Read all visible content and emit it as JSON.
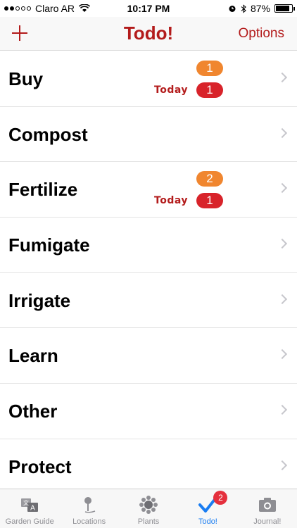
{
  "status_bar": {
    "carrier": "Claro AR",
    "time": "10:17 PM",
    "battery": "87%",
    "battery_level": 0.87
  },
  "nav": {
    "title": "Todo!",
    "options_label": "Options",
    "add_icon": "plus-icon"
  },
  "list": [
    {
      "label": "Buy",
      "pending": "1",
      "today_label": "Today",
      "today_count": "1"
    },
    {
      "label": "Compost"
    },
    {
      "label": "Fertilize",
      "pending": "2",
      "today_label": "Today",
      "today_count": "1"
    },
    {
      "label": "Fumigate"
    },
    {
      "label": "Irrigate"
    },
    {
      "label": "Learn"
    },
    {
      "label": "Other"
    },
    {
      "label": "Protect"
    }
  ],
  "tabs": [
    {
      "label": "Garden Guide",
      "icon": "garden-guide-icon"
    },
    {
      "label": "Locations",
      "icon": "location-pin-icon"
    },
    {
      "label": "Plants",
      "icon": "flower-icon"
    },
    {
      "label": "Todo!",
      "icon": "checkmark-icon",
      "badge": "2",
      "active": true
    },
    {
      "label": "Journal!",
      "icon": "camera-icon"
    }
  ],
  "colors": {
    "accent": "#b31b1b",
    "badge_orange": "#f0862f",
    "badge_red": "#d8232a",
    "tab_active": "#1a7df2"
  }
}
